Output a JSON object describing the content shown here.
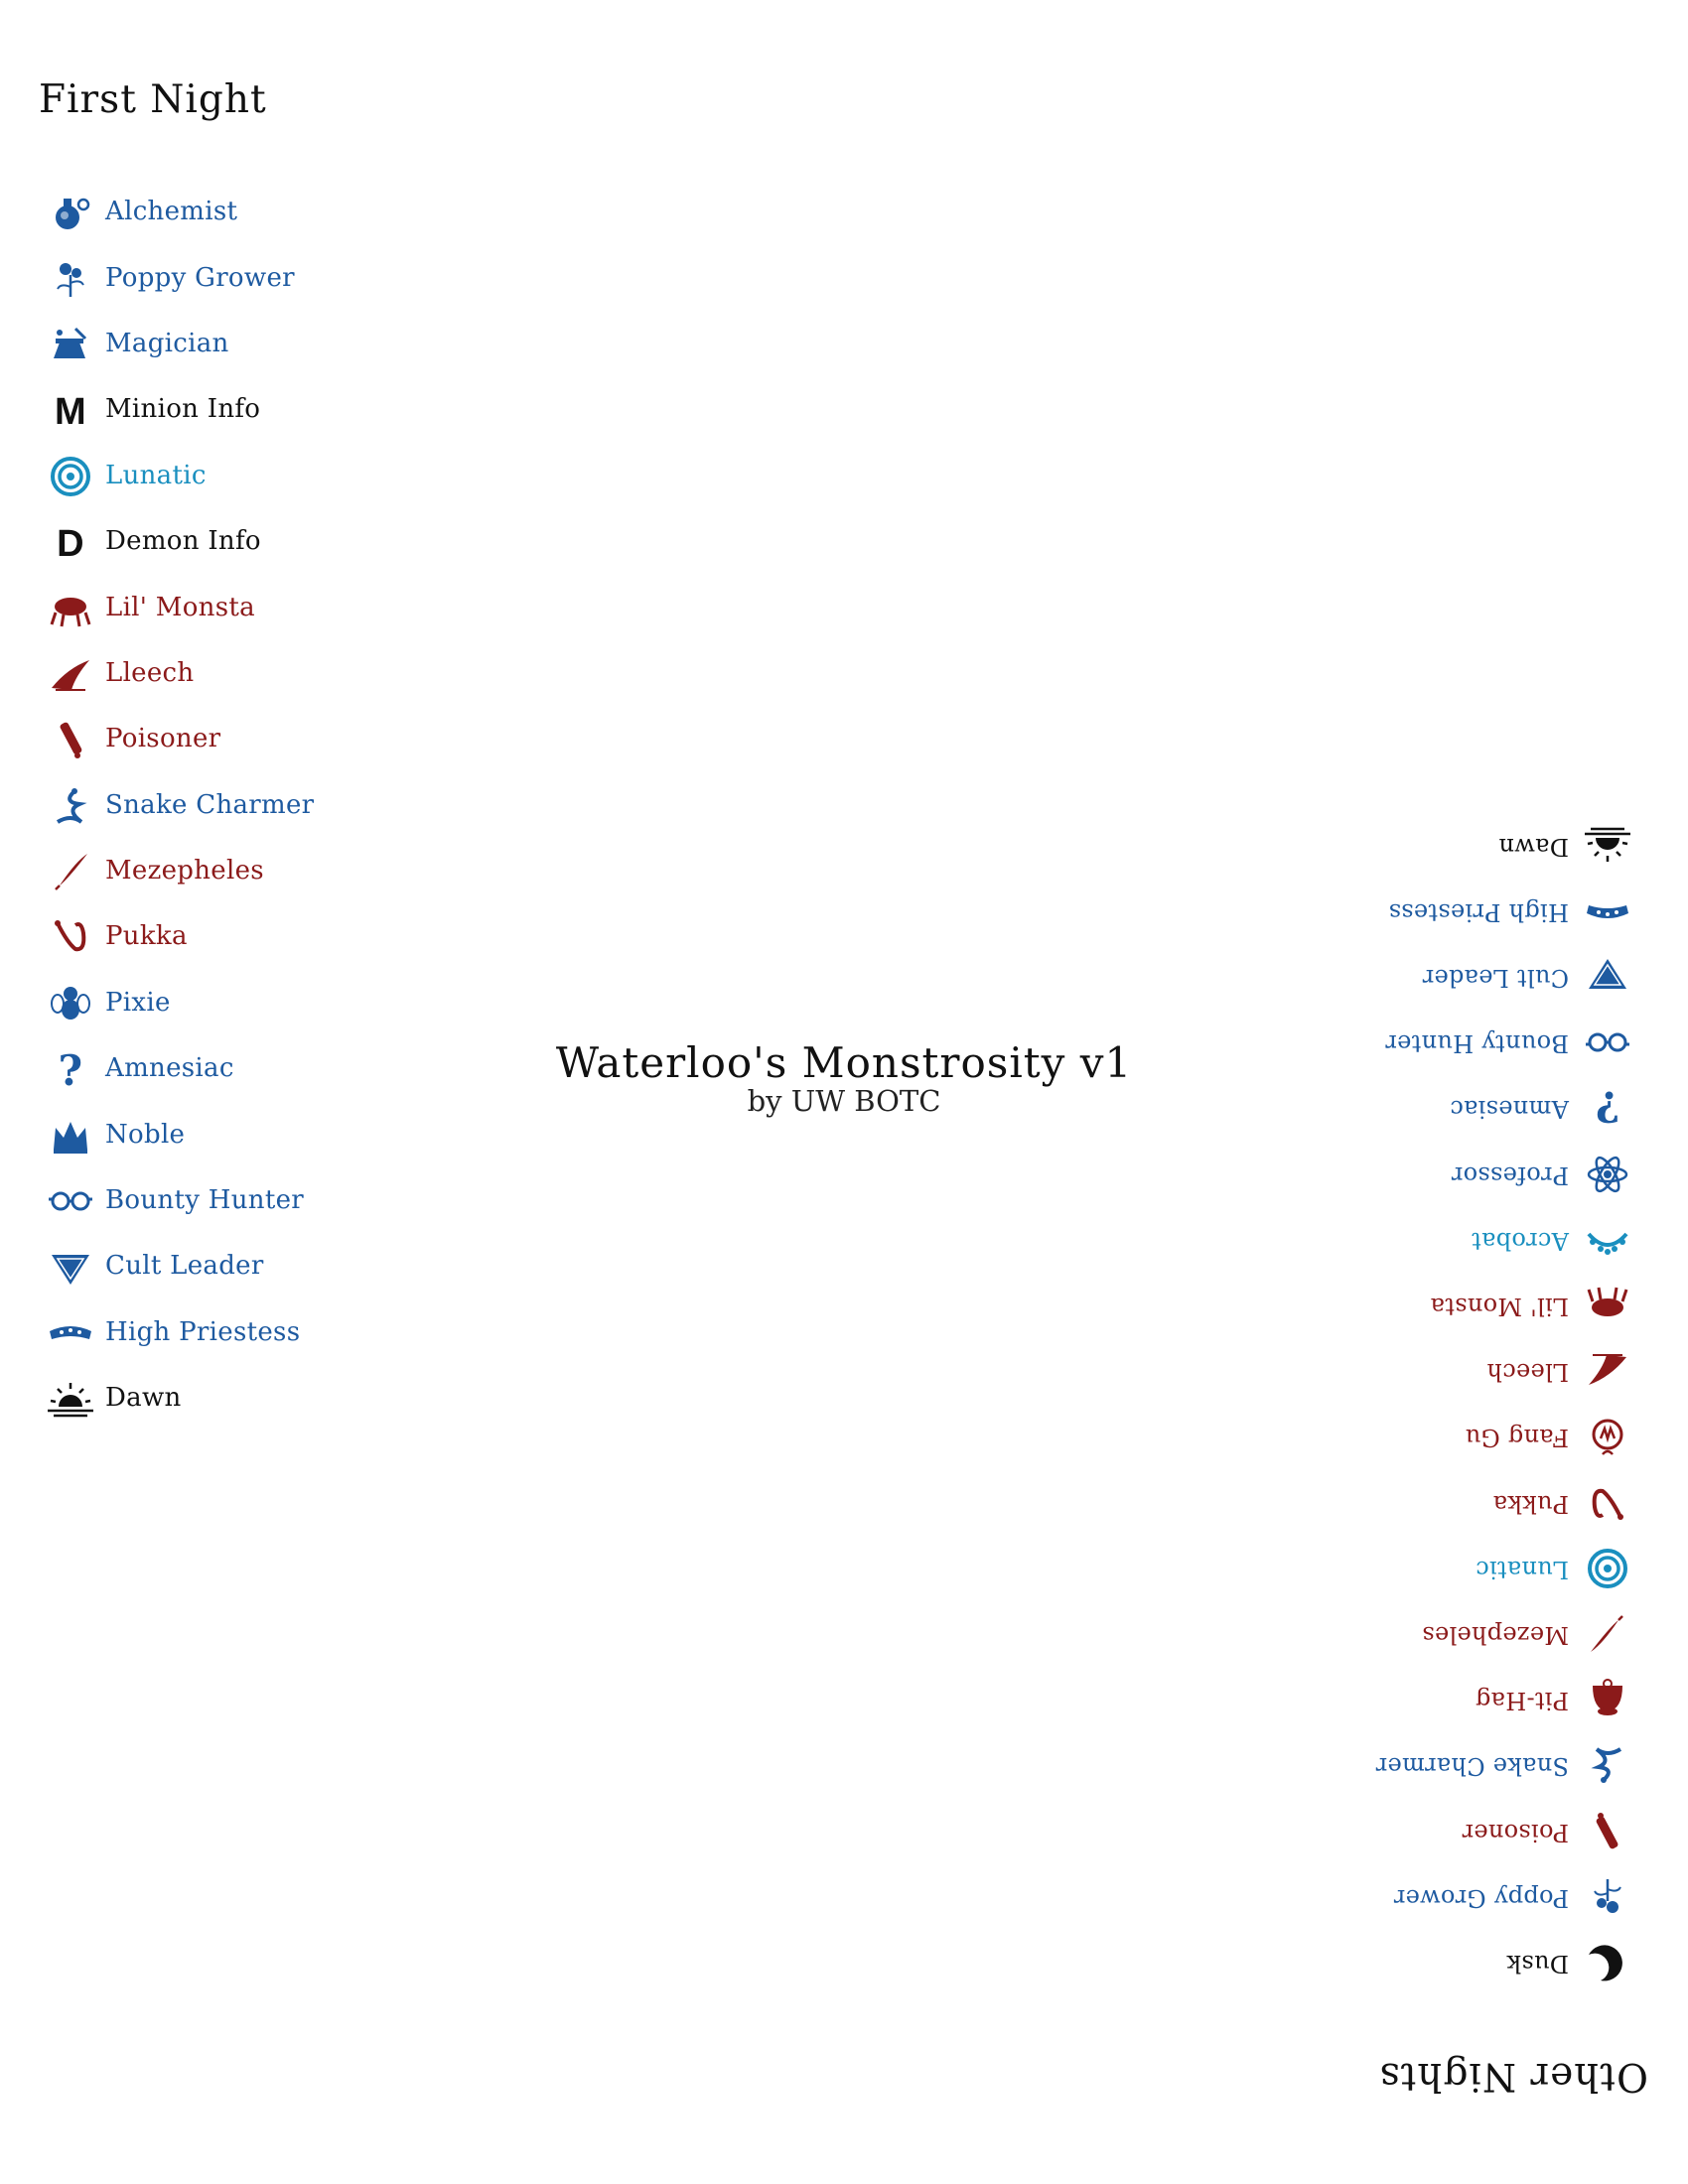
{
  "first_night": {
    "title": "First Night",
    "items": [
      {
        "label": "Alchemist",
        "icon": "alchemist-icon",
        "color": "#1e5aa0"
      },
      {
        "label": "Poppy Grower",
        "icon": "poppy-grower-icon",
        "color": "#1e5aa0"
      },
      {
        "label": "Magician",
        "icon": "magician-icon",
        "color": "#1e5aa0"
      },
      {
        "label": "Minion Info",
        "icon": "minion-info-icon",
        "color": "#111111"
      },
      {
        "label": "Lunatic",
        "icon": "lunatic-icon",
        "color": "#1a8fbf"
      },
      {
        "label": "Demon Info",
        "icon": "demon-info-icon",
        "color": "#111111"
      },
      {
        "label": "Lil' Monsta",
        "icon": "lil-monsta-icon",
        "color": "#8b1a1a"
      },
      {
        "label": "Lleech",
        "icon": "lleech-icon",
        "color": "#8b1a1a"
      },
      {
        "label": "Poisoner",
        "icon": "poisoner-icon",
        "color": "#8b1a1a"
      },
      {
        "label": "Snake Charmer",
        "icon": "snake-charmer-icon",
        "color": "#1e5aa0"
      },
      {
        "label": "Mezepheles",
        "icon": "mezepheles-icon",
        "color": "#8b1a1a"
      },
      {
        "label": "Pukka",
        "icon": "pukka-icon",
        "color": "#8b1a1a"
      },
      {
        "label": "Pixie",
        "icon": "pixie-icon",
        "color": "#1e5aa0"
      },
      {
        "label": "Amnesiac",
        "icon": "amnesiac-icon",
        "color": "#1e5aa0"
      },
      {
        "label": "Noble",
        "icon": "noble-icon",
        "color": "#1e5aa0"
      },
      {
        "label": "Bounty Hunter",
        "icon": "bounty-hunter-icon",
        "color": "#1e5aa0"
      },
      {
        "label": "Cult Leader",
        "icon": "cult-leader-icon",
        "color": "#1e5aa0"
      },
      {
        "label": "High Priestess",
        "icon": "high-priestess-icon",
        "color": "#1e5aa0"
      },
      {
        "label": "Dawn",
        "icon": "dawn-icon",
        "color": "#111111"
      }
    ]
  },
  "script": {
    "title": "Waterloo's Monstrosity v1",
    "author": "by UW BOTC"
  },
  "other_nights": {
    "title": "Other Nights",
    "items": [
      {
        "label": "Dusk",
        "icon": "dusk-icon",
        "color": "#111111"
      },
      {
        "label": "Poppy Grower",
        "icon": "poppy-grower-icon",
        "color": "#1e5aa0"
      },
      {
        "label": "Poisoner",
        "icon": "poisoner-icon",
        "color": "#8b1a1a"
      },
      {
        "label": "Snake Charmer",
        "icon": "snake-charmer-icon",
        "color": "#1e5aa0"
      },
      {
        "label": "Pit-Hag",
        "icon": "pit-hag-icon",
        "color": "#8b1a1a"
      },
      {
        "label": "Mezepheles",
        "icon": "mezepheles-icon",
        "color": "#8b1a1a"
      },
      {
        "label": "Lunatic",
        "icon": "lunatic-icon",
        "color": "#1a8fbf"
      },
      {
        "label": "Pukka",
        "icon": "pukka-icon",
        "color": "#8b1a1a"
      },
      {
        "label": "Fang Gu",
        "icon": "fang-gu-icon",
        "color": "#8b1a1a"
      },
      {
        "label": "Lleech",
        "icon": "lleech-icon",
        "color": "#8b1a1a"
      },
      {
        "label": "Lil' Monsta",
        "icon": "lil-monsta-icon",
        "color": "#8b1a1a"
      },
      {
        "label": "Acrobat",
        "icon": "acrobat-icon",
        "color": "#1a8fbf"
      },
      {
        "label": "Professor",
        "icon": "professor-icon",
        "color": "#1e5aa0"
      },
      {
        "label": "Amnesiac",
        "icon": "amnesiac-icon",
        "color": "#1e5aa0"
      },
      {
        "label": "Bounty Hunter",
        "icon": "bounty-hunter-icon",
        "color": "#1e5aa0"
      },
      {
        "label": "Cult Leader",
        "icon": "cult-leader-icon",
        "color": "#1e5aa0"
      },
      {
        "label": "High Priestess",
        "icon": "high-priestess-icon",
        "color": "#1e5aa0"
      },
      {
        "label": "Dawn",
        "icon": "dawn-icon",
        "color": "#111111"
      }
    ]
  }
}
